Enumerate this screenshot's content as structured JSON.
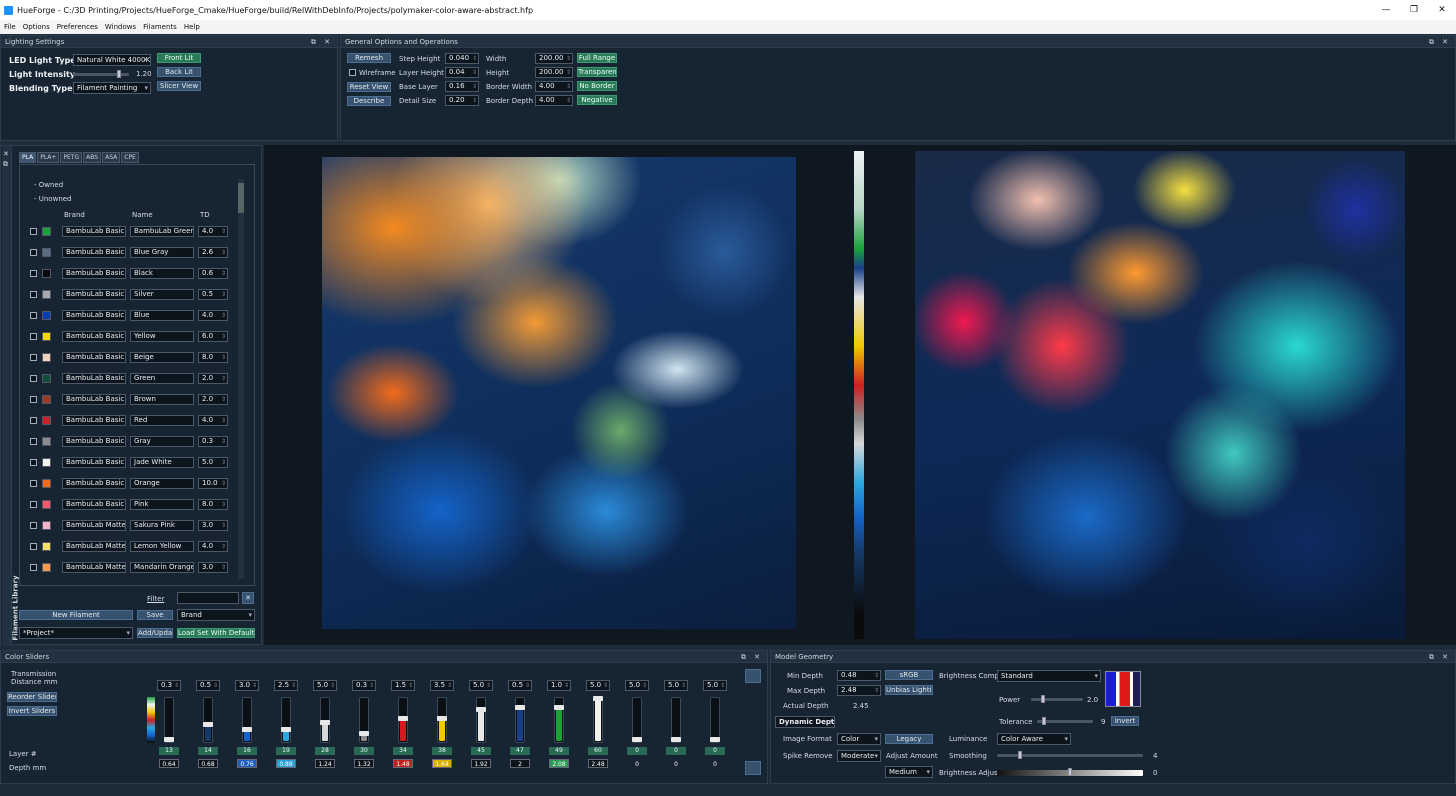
{
  "window": {
    "title": "HueForge - C:/3D Printing/Projects/HueForge_Cmake/HueForge/build/RelWithDebInfo/Projects/polymaker-color-aware-abstract.hfp",
    "controls": [
      "—",
      "❐",
      "✕"
    ]
  },
  "menu": [
    "File",
    "Options",
    "Preferences",
    "Windows",
    "Filaments",
    "Help"
  ],
  "lighting": {
    "title": "Lighting Settings",
    "led_label": "LED Light Type",
    "led_value": "Natural White 4000K",
    "intensity_label": "Light Intensity",
    "intensity_value": "1.20",
    "intensity_level": 0.85,
    "blending_label": "Blending Type",
    "blending_value": "Filament Painting",
    "front_lit": "Front Lit",
    "back_lit": "Back Lit",
    "slicer_view": "Slicer View"
  },
  "general": {
    "title": "General Options and Operations",
    "remesh": "Remesh",
    "wireframe": "Wireframe",
    "reset_view": "Reset View",
    "describe": "Describe",
    "step_height_label": "Step Height",
    "step_height": "0.040",
    "layer_height_label": "Layer Height",
    "layer_height": "0.04",
    "base_layer_label": "Base Layer",
    "base_layer": "0.16",
    "detail_size_label": "Detail Size",
    "detail_size": "0.20",
    "width_label": "Width",
    "width": "200.00",
    "height_label": "Height",
    "height": "200.00",
    "border_width_label": "Border Width",
    "border_width": "4.00",
    "border_depth_label": "Border Depth",
    "border_depth": "4.00",
    "full_range": "Full Range",
    "transparent": "Transparent",
    "no_border": "No Border",
    "negative": "Negative"
  },
  "library": {
    "side_label": "Filament Library",
    "tabs": [
      "PLA",
      "PLA+",
      "PETG",
      "ABS",
      "ASA",
      "CPE"
    ],
    "owned": "- Owned",
    "unowned": "- Unowned",
    "col_brand": "Brand",
    "col_name": "Name",
    "col_td": "TD",
    "rows": [
      {
        "brand": "BambuLab Basic",
        "name": "BambuLab Green",
        "td": "4.0",
        "color": "#19a33a"
      },
      {
        "brand": "BambuLab Basic",
        "name": "Blue Gray",
        "td": "2.6",
        "color": "#5b6d83"
      },
      {
        "brand": "BambuLab Basic",
        "name": "Black",
        "td": "0.6",
        "color": "#0b0b0b"
      },
      {
        "brand": "BambuLab Basic",
        "name": "Silver",
        "td": "0.5",
        "color": "#a5a8ad"
      },
      {
        "brand": "BambuLab Basic",
        "name": "Blue",
        "td": "4.0",
        "color": "#0b3fb0"
      },
      {
        "brand": "BambuLab Basic",
        "name": "Yellow",
        "td": "6.0",
        "color": "#f5d800"
      },
      {
        "brand": "BambuLab Basic",
        "name": "Beige",
        "td": "8.0",
        "color": "#efd3bd"
      },
      {
        "brand": "BambuLab Basic",
        "name": "Green",
        "td": "2.0",
        "color": "#104d3a"
      },
      {
        "brand": "BambuLab Basic",
        "name": "Brown",
        "td": "2.0",
        "color": "#9a3b24"
      },
      {
        "brand": "BambuLab Basic",
        "name": "Red",
        "td": "4.0",
        "color": "#cc1f2e"
      },
      {
        "brand": "BambuLab Basic",
        "name": "Gray",
        "td": "0.3",
        "color": "#8c8c8c"
      },
      {
        "brand": "BambuLab Basic",
        "name": "Jade White",
        "td": "5.0",
        "color": "#f4f4ef"
      },
      {
        "brand": "BambuLab Basic",
        "name": "Orange",
        "td": "10.0",
        "color": "#f26b1c"
      },
      {
        "brand": "BambuLab Basic",
        "name": "Pink",
        "td": "8.0",
        "color": "#ef5b6b"
      },
      {
        "brand": "BambuLab Matte",
        "name": "Sakura Pink",
        "td": "3.0",
        "color": "#f1b5c9"
      },
      {
        "brand": "BambuLab Matte",
        "name": "Lemon Yellow",
        "td": "4.0",
        "color": "#f4e06a"
      },
      {
        "brand": "BambuLab Matte",
        "name": "Mandarin Orange",
        "td": "3.0",
        "color": "#f39a4e"
      }
    ],
    "filter_label": "Filter",
    "new_filament": "New Filament",
    "save": "Save",
    "sort_value": "Brand",
    "project_value": "*Project*",
    "add_update": "Add/Update",
    "load_set": "Load Set With Defaults"
  },
  "color_sliders": {
    "title": "Color Sliders",
    "td_label": "Transmission Distance mm",
    "reorder": "Reorder Sliders",
    "invert": "Invert Sliders",
    "layer_label": "Layer #",
    "depth_label": "Depth mm",
    "sliders": [
      {
        "td": "0.3",
        "layer": "13",
        "depth": "0.64",
        "color": "#0b0b0b",
        "level": 0.05,
        "depth_bg": "#0c141c"
      },
      {
        "td": "0.5",
        "layer": "14",
        "depth": "0.68",
        "color": "#153a6a",
        "level": 0.4,
        "depth_bg": "#0c141c"
      },
      {
        "td": "3.0",
        "layer": "16",
        "depth": "0.76",
        "color": "#1463c8",
        "level": 0.3,
        "depth_bg": "#1e5fc0"
      },
      {
        "td": "2.5",
        "layer": "19",
        "depth": "0.88",
        "color": "#2aa8e0",
        "level": 0.3,
        "depth_bg": "#2aa0d8"
      },
      {
        "td": "5.0",
        "layer": "28",
        "depth": "1.24",
        "color": "#d8d8d8",
        "level": 0.45,
        "depth_bg": "#0c141c"
      },
      {
        "td": "0.3",
        "layer": "30",
        "depth": "1.32",
        "color": "#8c8c8c",
        "level": 0.2,
        "depth_bg": "#0c141c"
      },
      {
        "td": "1.5",
        "layer": "34",
        "depth": "1.48",
        "color": "#cc2020",
        "level": 0.55,
        "depth_bg": "#c02020"
      },
      {
        "td": "3.5",
        "layer": "38",
        "depth": "1.64",
        "color": "#f0c800",
        "level": 0.55,
        "depth_bg": "#d8b000"
      },
      {
        "td": "5.0",
        "layer": "45",
        "depth": "1.92",
        "color": "#e8e8e8",
        "level": 0.75,
        "depth_bg": "#0c141c"
      },
      {
        "td": "0.5",
        "layer": "47",
        "depth": "2",
        "color": "#1a3f8a",
        "level": 0.8,
        "depth_bg": "#0c141c"
      },
      {
        "td": "1.0",
        "layer": "49",
        "depth": "2.08",
        "color": "#19a33a",
        "level": 0.8,
        "depth_bg": "#2a9a55"
      },
      {
        "td": "5.0",
        "layer": "60",
        "depth": "2.48",
        "color": "#f4f4ef",
        "level": 1.0,
        "depth_bg": "#0c141c"
      },
      {
        "td": "5.0",
        "layer": "0",
        "depth": "0",
        "color": "#e8e8e8",
        "level": 0.0,
        "depth_bg": "transparent"
      },
      {
        "td": "5.0",
        "layer": "0",
        "depth": "0",
        "color": "#e8e8e8",
        "level": 0.0,
        "depth_bg": "transparent"
      },
      {
        "td": "5.0",
        "layer": "0",
        "depth": "0",
        "color": "#e8e8e8",
        "level": 0.0,
        "depth_bg": "transparent"
      }
    ]
  },
  "model": {
    "title": "Model Geometry",
    "min_depth_label": "Min Depth",
    "min_depth": "0.48",
    "max_depth_label": "Max Depth",
    "max_depth": "2.48",
    "actual_depth_label": "Actual Depth",
    "actual_depth": "2.45",
    "srgb": "sRGB",
    "unbias": "Unbias Lighting",
    "dynamic_depth": "Dynamic Depth",
    "image_format_label": "Image Format",
    "image_format": "Color",
    "legacy": "Legacy",
    "spike_label": "Spike Remove",
    "spike": "Moderate",
    "adjust_label": "Adjust Amount",
    "adjust": "Medium",
    "brightness_comp_label": "Brightness Comp",
    "brightness_comp": "Standard",
    "power_label": "Power",
    "power": "2.0",
    "power_level": 0.2,
    "tolerance_label": "Tolerance",
    "tolerance": "9",
    "tolerance_level": 0.1,
    "invert": "Invert",
    "luminance_label": "Luminance",
    "luminance": "Color Aware",
    "smoothing_label": "Smoothing",
    "smoothing": "4",
    "smoothing_level": 0.15,
    "brightness_adjust_label": "Brightness Adjust",
    "brightness_adjust": "0",
    "brightness_adjust_level": 0.5
  }
}
